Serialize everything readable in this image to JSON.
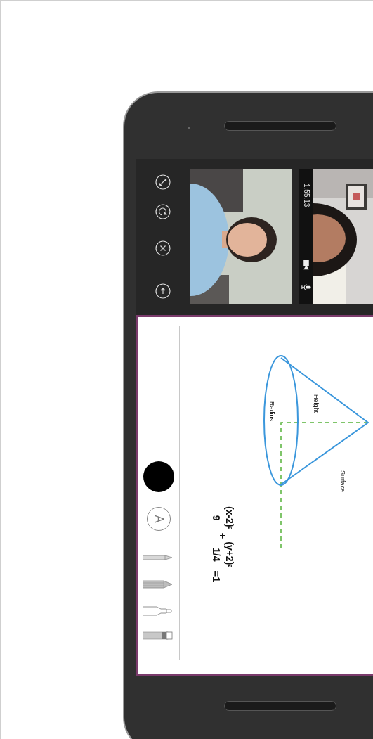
{
  "video_call": {
    "call_timer": "1:55:13"
  },
  "whiteboard": {
    "diagram_labels": [
      "Height",
      "Radius",
      "Surface"
    ],
    "equation": {
      "terms": [
        {
          "numerator": "(x-2)",
          "exponent": "2",
          "denominator": "9"
        },
        {
          "numerator": "(y+2)",
          "exponent": "2",
          "denominator": "1/4"
        }
      ],
      "operator": "+",
      "result": "=1"
    },
    "text_tool": "A"
  }
}
